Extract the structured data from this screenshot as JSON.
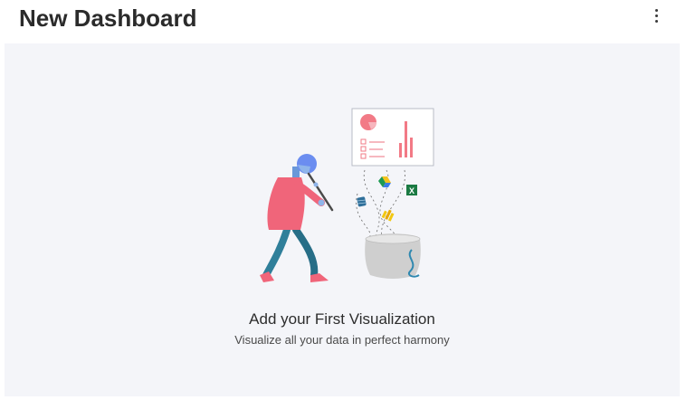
{
  "header": {
    "title": "New Dashboard"
  },
  "menu": {
    "icon": "more-vertical-icon"
  },
  "empty_state": {
    "title": "Add your First Visualization",
    "subtitle": "Visualize all your data in perfect harmony",
    "illustration_icons": [
      "chart-board-icon",
      "google-drive-icon",
      "excel-icon",
      "database-icon",
      "power-bi-icon",
      "data-basket-icon"
    ]
  },
  "colors": {
    "canvas_bg": "#f4f5f9",
    "accent_pink": "#f0657a",
    "accent_teal": "#2f7f9a",
    "accent_blue": "#6b8df0"
  }
}
